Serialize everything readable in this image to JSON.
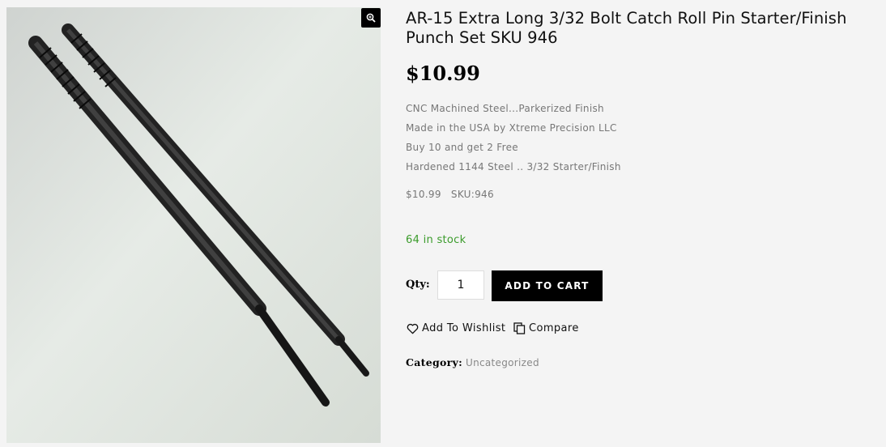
{
  "product": {
    "title": "AR-15 Extra Long 3/32 Bolt Catch Roll Pin Starter/Finish Punch Set SKU 946",
    "price": "$10.99",
    "description_lines": [
      "CNC Machined Steel...Parkerized Finish",
      "Made in the USA by Xtreme Precision LLC",
      "Buy 10 and get 2 Free",
      "Hardened 1144 Steel .. 3/32 Starter/Finish"
    ],
    "meta_price": "$10.99",
    "meta_sku": "SKU:946",
    "stock": "64 in stock"
  },
  "cart": {
    "qty_label": "Qty:",
    "qty_value": "1",
    "add_to_cart_label": "ADD TO CART"
  },
  "actions": {
    "wishlist_label": "Add To Wishlist",
    "compare_label": "Compare"
  },
  "category": {
    "label": "Category:",
    "value": "Uncategorized"
  },
  "gallery": {
    "zoom_icon": "magnifier-plus-icon"
  },
  "colors": {
    "stock_green": "#3a9b2a",
    "button_black": "#000000"
  }
}
